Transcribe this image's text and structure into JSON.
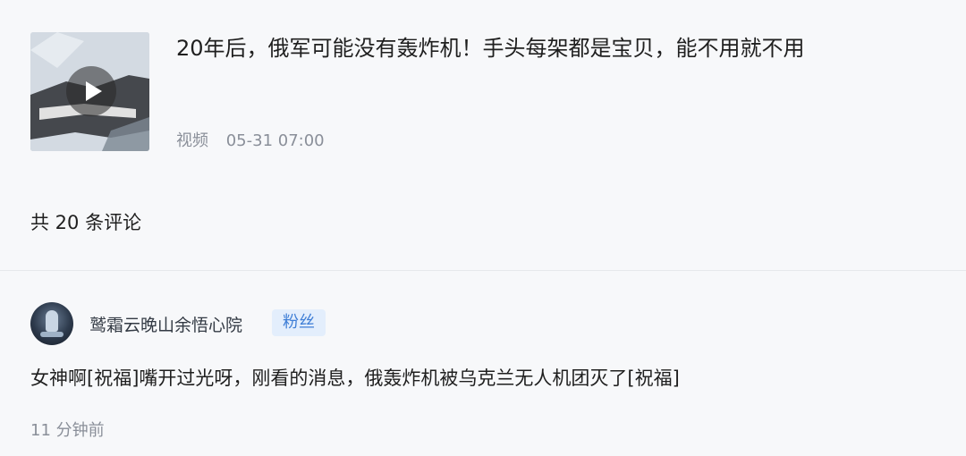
{
  "video": {
    "title": "20年后，俄军可能没有轰炸机！手头每架都是宝贝，能不用就不用",
    "type_label": "视频",
    "datetime": "05-31 07:00",
    "thumbnail_icon": "play-icon"
  },
  "comments_header": {
    "count_text": "共 20 条评论"
  },
  "comment": {
    "username": "鹫霜云晚山余悟心院",
    "badge": "粉丝",
    "text": "女神啊[祝福]嘴开过光呀，刚看的消息，俄轰炸机被乌克兰无人机团灭了[祝福]",
    "time": "11 分钟前"
  },
  "colors": {
    "page_background": "#f7f8fa",
    "badge_text": "#3e7ed6",
    "badge_background": "#e3eefc",
    "meta_text": "#8a8f99"
  }
}
